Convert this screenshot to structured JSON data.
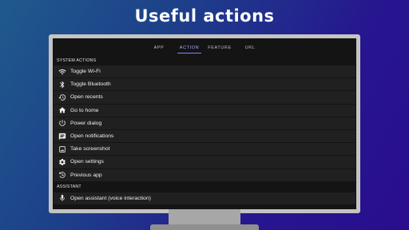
{
  "headline": "Useful actions",
  "tabs": [
    {
      "label": "APP",
      "active": false
    },
    {
      "label": "ACTION",
      "active": true
    },
    {
      "label": "FEATURE",
      "active": false
    },
    {
      "label": "URL",
      "active": false
    }
  ],
  "sections": [
    {
      "title": "SYSTEM ACTIONS",
      "items": [
        {
          "label": "Toggle Wi-Fi",
          "icon": "wifi-icon"
        },
        {
          "label": "Toggle Bluetooth",
          "icon": "bluetooth-icon"
        },
        {
          "label": "Open recents",
          "icon": "history-icon"
        },
        {
          "label": "Go to home",
          "icon": "home-icon"
        },
        {
          "label": "Power dialog",
          "icon": "power-icon"
        },
        {
          "label": "Open notifications",
          "icon": "notification-message-icon"
        },
        {
          "label": "Take screenshot",
          "icon": "image-icon"
        },
        {
          "label": "Open settings",
          "icon": "gear-icon"
        },
        {
          "label": "Previous app",
          "icon": "back-history-icon"
        }
      ]
    },
    {
      "title": "ASSISTANT",
      "items": [
        {
          "label": "Open assistant (voice interaction)",
          "icon": "microphone-icon"
        }
      ]
    }
  ],
  "colors": {
    "accent": "#8d7dff",
    "screen_bg": "#141414",
    "row_bg": "#202020",
    "bezel": "#c4c4c4"
  }
}
